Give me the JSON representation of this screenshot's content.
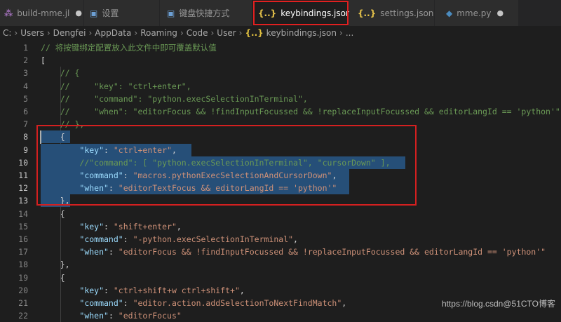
{
  "tabs": [
    {
      "icon": "julia-icon",
      "label": "build-mme.jl",
      "dot": "●"
    },
    {
      "icon": "settings-icon",
      "label": "设置"
    },
    {
      "icon": "keyboard-icon",
      "label": "键盘快捷方式"
    },
    {
      "icon": "json-icon",
      "label": "keybindings.json",
      "close": "×"
    },
    {
      "icon": "json-icon",
      "label": "settings.json"
    },
    {
      "icon": "python-icon",
      "label": "mme.py",
      "dot": "●"
    }
  ],
  "breadcrumb": {
    "parts": [
      "C:",
      "Users",
      "Dengfei",
      "AppData",
      "Roaming",
      "Code",
      "User"
    ],
    "file": "keybindings.json",
    "more": "..."
  },
  "editor": {
    "lines": [
      {
        "n": "1",
        "tokens": [
          [
            "c",
            "// 将按键绑定配置放入此文件中即可覆盖默认值"
          ]
        ]
      },
      {
        "n": "2",
        "tokens": [
          [
            "p",
            "["
          ]
        ]
      },
      {
        "n": "3",
        "tokens": [
          [
            "c",
            "    // {"
          ]
        ]
      },
      {
        "n": "4",
        "tokens": [
          [
            "c",
            "    //     \"key\": \"ctrl+enter\","
          ]
        ]
      },
      {
        "n": "5",
        "tokens": [
          [
            "c",
            "    //     \"command\": \"python.execSelectionInTerminal\","
          ]
        ]
      },
      {
        "n": "6",
        "tokens": [
          [
            "c",
            "    //     \"when\": \"editorFocus && !findInputFocussed && !replaceInputFocussed && editorLangId == 'python'\""
          ]
        ]
      },
      {
        "n": "7",
        "tokens": [
          [
            "c",
            "    // },"
          ]
        ]
      },
      {
        "n": "8",
        "tokens": [
          [
            "p",
            "    {"
          ]
        ]
      },
      {
        "n": "9",
        "tokens": [
          [
            "p",
            "        "
          ],
          [
            "k",
            "\"key\""
          ],
          [
            "p",
            ": "
          ],
          [
            "s",
            "\"ctrl+enter\""
          ],
          [
            "p",
            ","
          ]
        ]
      },
      {
        "n": "10",
        "tokens": [
          [
            "c",
            "        //\"command\": [ \"python.execSelectionInTerminal\", \"cursorDown\" ],"
          ]
        ]
      },
      {
        "n": "11",
        "tokens": [
          [
            "p",
            "        "
          ],
          [
            "k",
            "\"command\""
          ],
          [
            "p",
            ": "
          ],
          [
            "s",
            "\"macros.pythonExecSelectionAndCursorDown\""
          ],
          [
            "p",
            ","
          ]
        ]
      },
      {
        "n": "12",
        "tokens": [
          [
            "p",
            "        "
          ],
          [
            "k",
            "\"when\""
          ],
          [
            "p",
            ": "
          ],
          [
            "s",
            "\"editorTextFocus && editorLangId == 'python'\""
          ]
        ]
      },
      {
        "n": "13",
        "tokens": [
          [
            "p",
            "    },"
          ]
        ]
      },
      {
        "n": "14",
        "tokens": [
          [
            "p",
            "    {"
          ]
        ]
      },
      {
        "n": "15",
        "tokens": [
          [
            "p",
            "        "
          ],
          [
            "k",
            "\"key\""
          ],
          [
            "p",
            ": "
          ],
          [
            "s",
            "\"shift+enter\""
          ],
          [
            "p",
            ","
          ]
        ]
      },
      {
        "n": "16",
        "tokens": [
          [
            "p",
            "        "
          ],
          [
            "k",
            "\"command\""
          ],
          [
            "p",
            ": "
          ],
          [
            "s",
            "\"-python.execSelectionInTerminal\""
          ],
          [
            "p",
            ","
          ]
        ]
      },
      {
        "n": "17",
        "tokens": [
          [
            "p",
            "        "
          ],
          [
            "k",
            "\"when\""
          ],
          [
            "p",
            ": "
          ],
          [
            "s",
            "\"editorFocus && !findInputFocussed && !replaceInputFocussed && editorLangId == 'python'\""
          ]
        ]
      },
      {
        "n": "18",
        "tokens": [
          [
            "p",
            "    },"
          ]
        ]
      },
      {
        "n": "19",
        "tokens": [
          [
            "p",
            "    {"
          ]
        ]
      },
      {
        "n": "20",
        "tokens": [
          [
            "p",
            "        "
          ],
          [
            "k",
            "\"key\""
          ],
          [
            "p",
            ": "
          ],
          [
            "s",
            "\"ctrl+shift+w ctrl+shift+\""
          ],
          [
            "p",
            ","
          ]
        ]
      },
      {
        "n": "21",
        "tokens": [
          [
            "p",
            "        "
          ],
          [
            "k",
            "\"command\""
          ],
          [
            "p",
            ": "
          ],
          [
            "s",
            "\"editor.action.addSelectionToNextFindMatch\""
          ],
          [
            "p",
            ","
          ]
        ]
      },
      {
        "n": "22",
        "tokens": [
          [
            "p",
            "        "
          ],
          [
            "k",
            "\"when\""
          ],
          [
            "p",
            ": "
          ],
          [
            "s",
            "\"editorFocus\""
          ]
        ]
      }
    ]
  },
  "watermark": "https://blog.csdn@51CTO博客"
}
